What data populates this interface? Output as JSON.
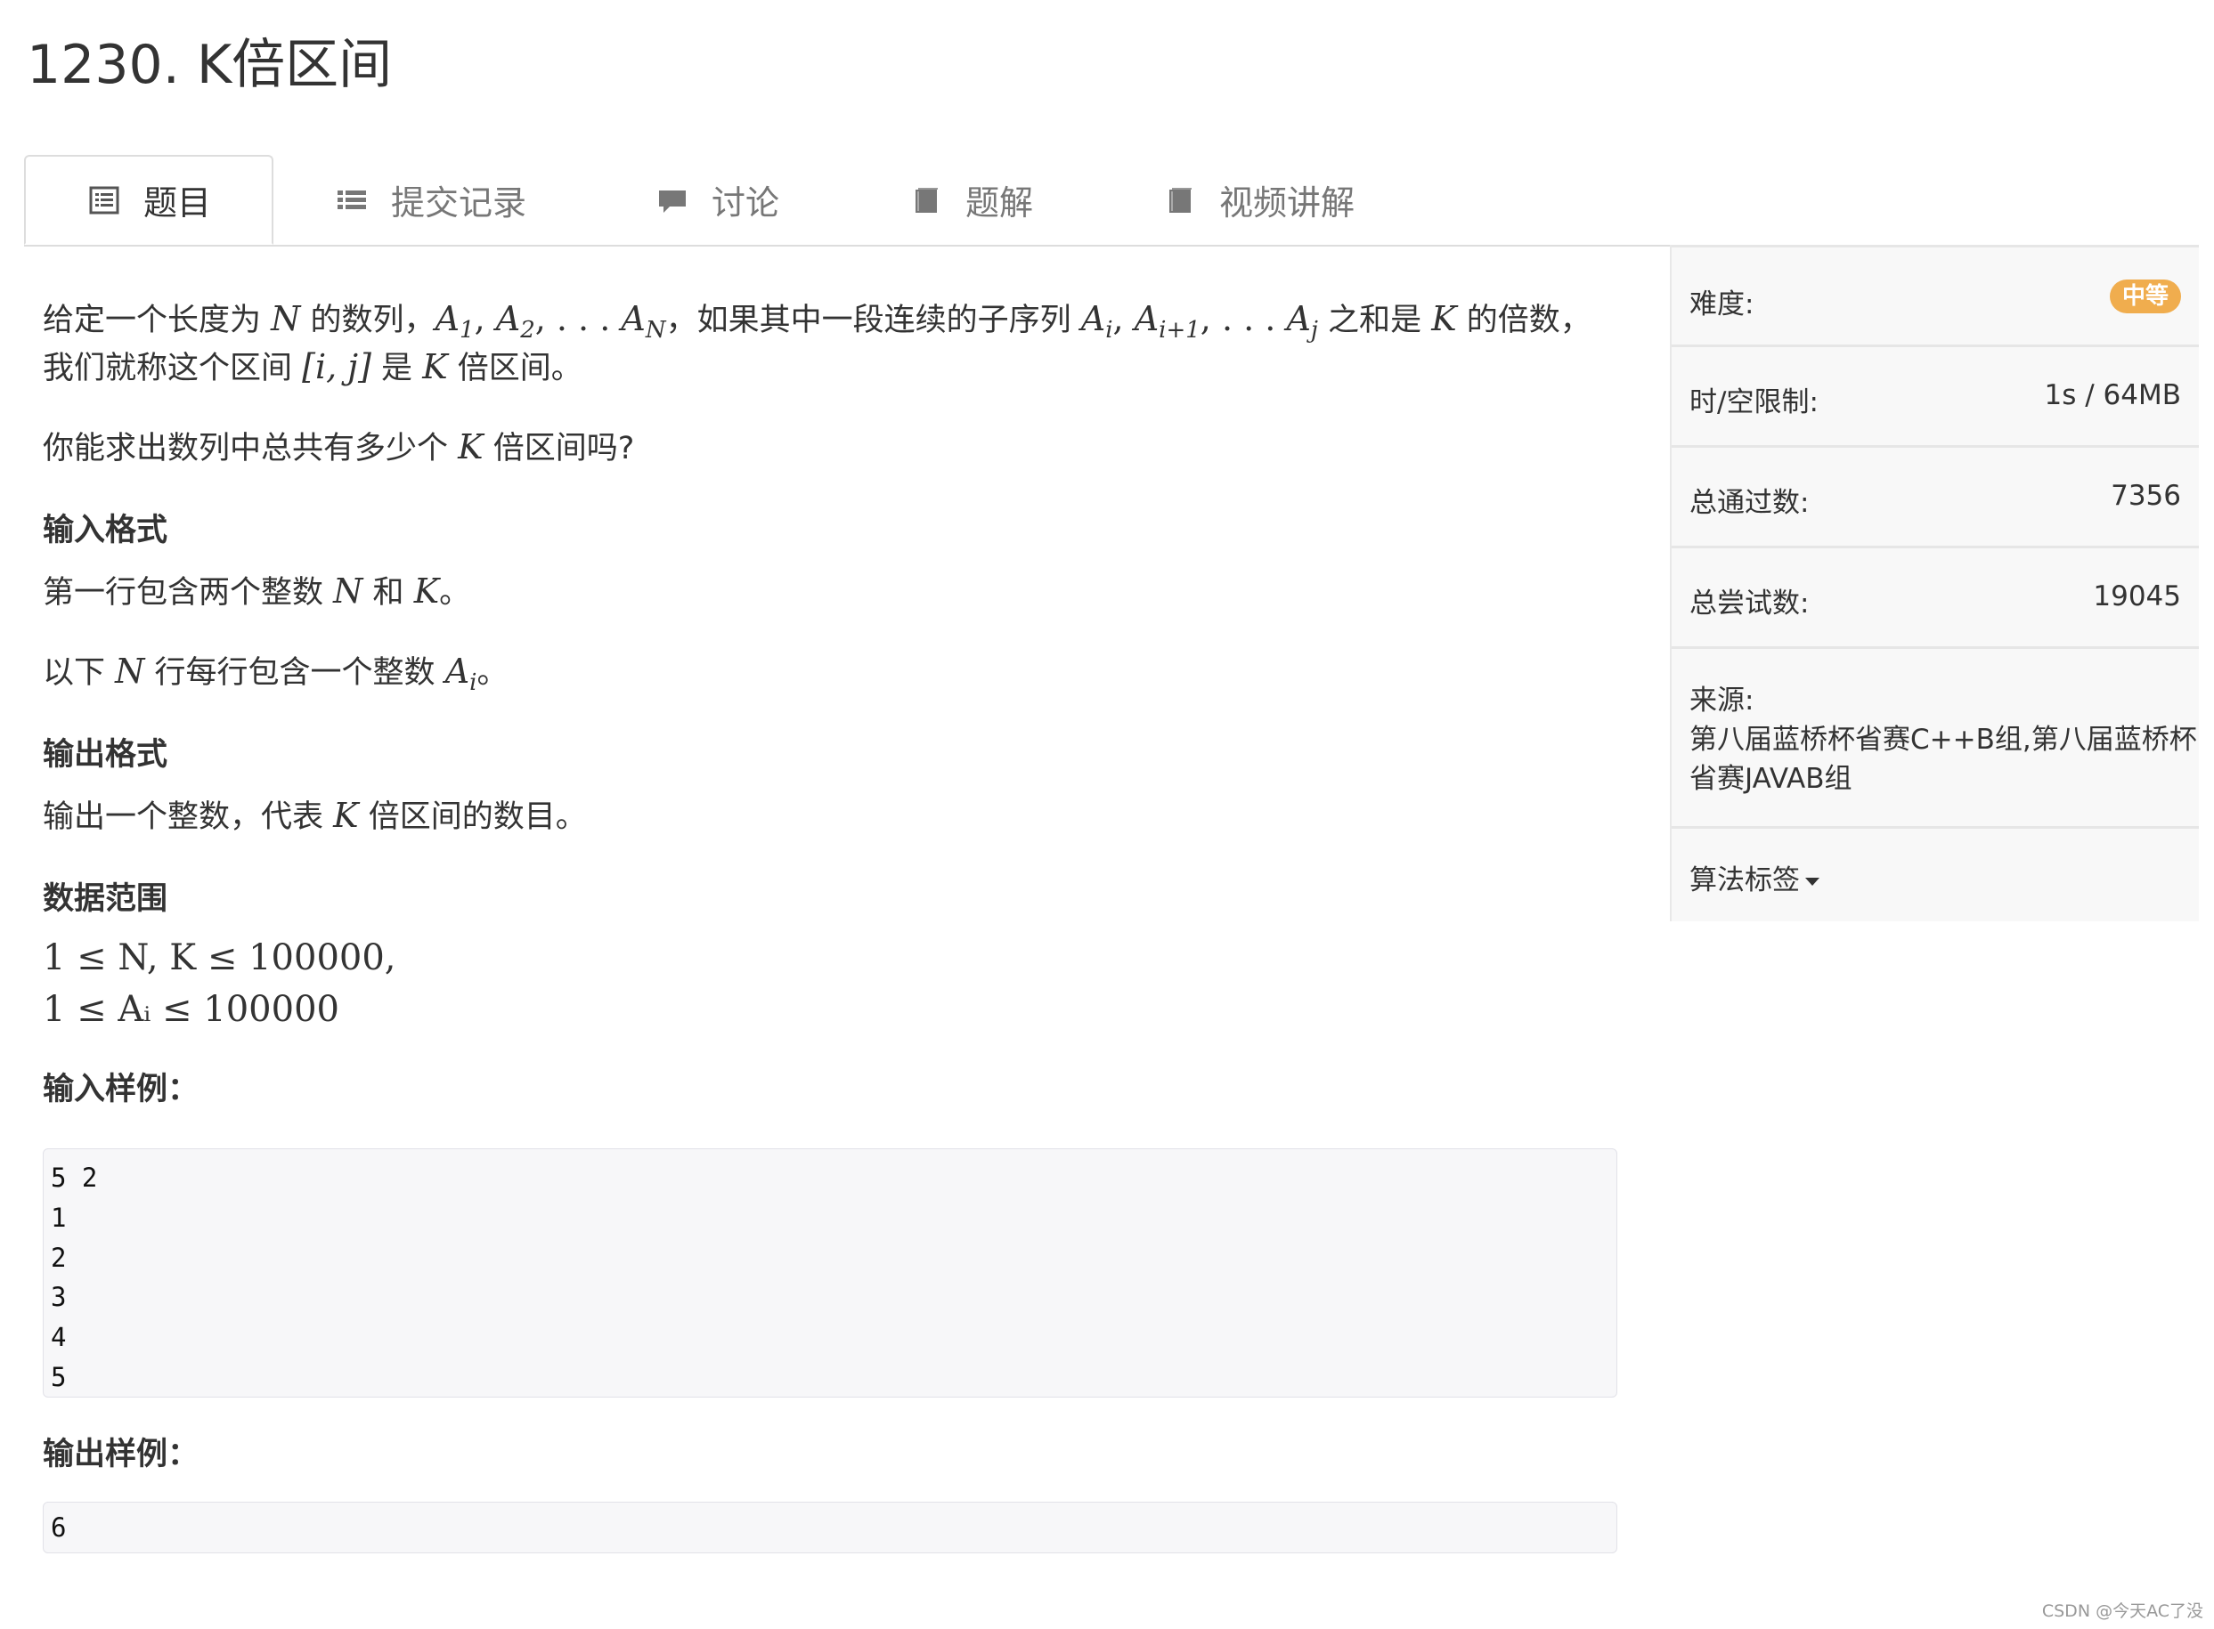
{
  "page": {
    "title": "1230. K倍区间"
  },
  "tabs": [
    {
      "label": "题目",
      "icon": "list-alt-icon",
      "active": true
    },
    {
      "label": "提交记录",
      "icon": "list-icon",
      "active": false
    },
    {
      "label": "讨论",
      "icon": "comment-icon",
      "active": false
    },
    {
      "label": "题解",
      "icon": "book-icon",
      "active": false
    },
    {
      "label": "视频讲解",
      "icon": "book-icon",
      "active": false
    }
  ],
  "problem": {
    "desc1_a": "给定一个长度为",
    "desc1_b": "的数列，",
    "desc1_c": "，如果其中一段连续的子序列",
    "desc1_d": "之和是",
    "desc1_e": "的倍数，",
    "desc2_a": "我们就称这个区间",
    "desc2_b": "是",
    "desc2_c": "倍区间。",
    "question_a": "你能求出数列中总共有多少个",
    "question_b": "倍区间吗?",
    "input_heading": "输入格式",
    "input1_a": "第一行包含两个整数",
    "input1_b": "和",
    "input1_c": "。",
    "input2_a": "以下",
    "input2_b": "行每行包含一个整数",
    "input2_c": "。",
    "output_heading": "输出格式",
    "output_a": "输出一个整数，代表",
    "output_b": "倍区间的数目。",
    "range_heading": "数据范围",
    "range1": "1 ≤ N, K ≤ 100000,",
    "range2": "1 ≤ Aᵢ ≤ 100000",
    "sample_in_heading": "输入样例：",
    "sample_input": [
      "5 2",
      "1",
      "2",
      "3",
      "4",
      "5"
    ],
    "sample_out_heading": "输出样例：",
    "sample_output": [
      "6"
    ],
    "sym_N": "N",
    "sym_K": "K",
    "sym_A": "A",
    "sym_i": "i",
    "interval": "[i, j]"
  },
  "sidebar": {
    "difficulty_label": "难度:",
    "difficulty_value": "中等",
    "limit_label": "时/空限制:",
    "limit_value": "1s / 64MB",
    "passed_label": "总通过数:",
    "passed_value": "7356",
    "tries_label": "总尝试数:",
    "tries_value": "19045",
    "source_label": "来源:",
    "source_value_1": "第八届蓝桥杯省赛C++B组,第八届蓝桥杯",
    "source_value_2": "省赛JAVAB组",
    "tags_label": "算法标签"
  },
  "colors": {
    "badge": "#f0ad4e",
    "tab_text": "#777777",
    "sidebar_bg": "#f8f8f8",
    "code_bg": "#f7f7f9"
  },
  "watermark": "CSDN @今天AC了没"
}
